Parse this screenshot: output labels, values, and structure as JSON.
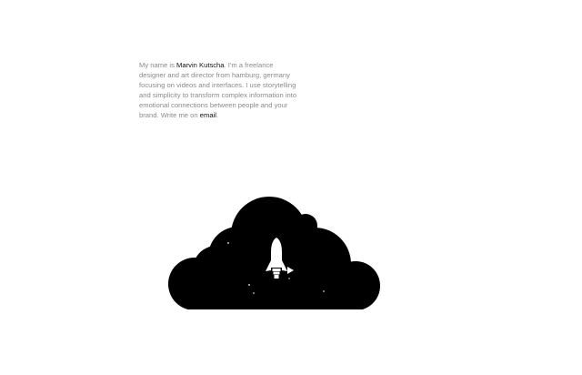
{
  "intro": {
    "prefix": "My name is ",
    "name": "Marvin Kutscha",
    "body": ". I'm a freelance designer and art director from hamburg, germany focusing on videos and interfaces. I use storytelling and simplicity to transform complex information into emotional connections between people and your brand. Write me on ",
    "email_label": "email",
    "suffix": "."
  },
  "colors": {
    "text_muted": "#8a8a8a",
    "text_strong": "#111111",
    "cloud": "#000000",
    "rocket": "#ffffff",
    "background": "#ffffff"
  },
  "illustration": {
    "cloud_icon": "cloud-icon",
    "rocket_icon": "rocket-icon",
    "play_icon": "play-icon"
  }
}
